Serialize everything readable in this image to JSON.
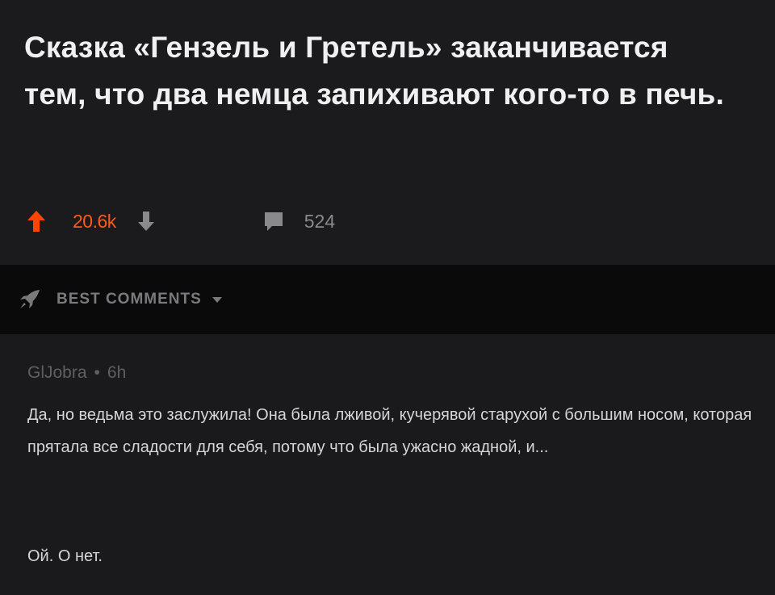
{
  "post": {
    "title": "Сказка «Гензель и Гретель» заканчивается тем, что два немца запихивают кого-то в печь.",
    "vote_count": "20.6k",
    "comment_count": "524",
    "icons": {
      "upvote": "arrow-up-icon",
      "downvote": "arrow-down-icon",
      "comments": "comment-bubble-icon"
    }
  },
  "sort": {
    "label": "BEST COMMENTS",
    "icon": "rocket-icon",
    "caret": "chevron-down-icon"
  },
  "comment": {
    "author": "GlJobra",
    "separator": "•",
    "time": "6h",
    "text": "Да, но ведьма это заслужила! Она была лживой, кучерявой старухой с большим носом, которая прятала все сладости для себя, потому что была ужасно жадной, и...",
    "reply": "Ой. О нет."
  },
  "colors": {
    "upvote_active": "#ff5a1a",
    "background": "#1a1a1b",
    "sort_bar": "#0a0a0b"
  }
}
